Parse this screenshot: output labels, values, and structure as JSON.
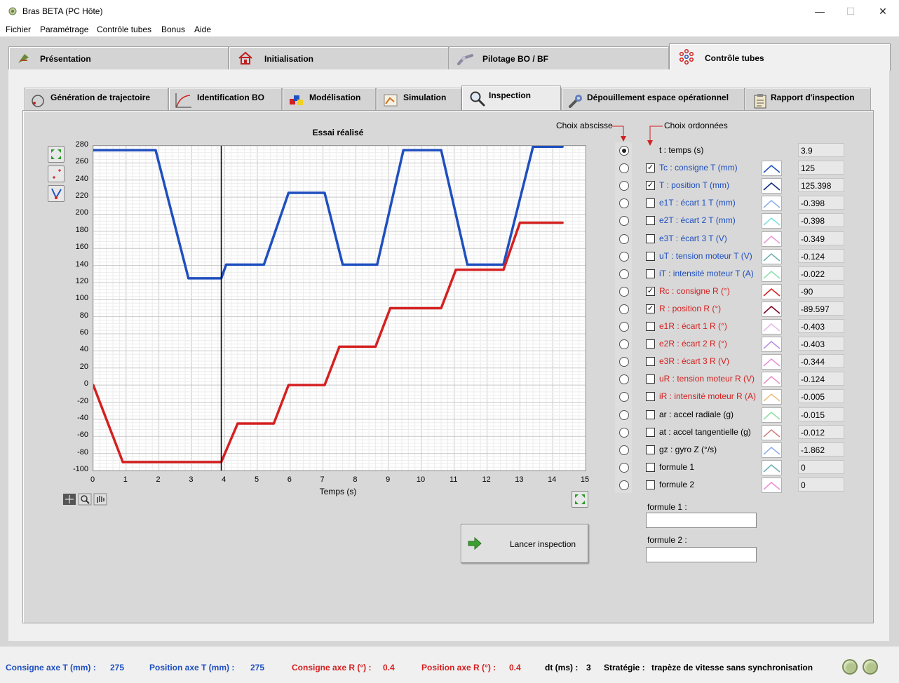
{
  "window": {
    "title": "Bras BETA (PC Hôte)",
    "minimize": "—",
    "maximize": "☐",
    "close": "✕"
  },
  "menu": [
    "Fichier",
    "Paramétrage",
    "Contrôle tubes",
    "Bonus",
    "Aide"
  ],
  "top_tabs": [
    "Présentation",
    "Initialisation",
    "Pilotage BO / BF",
    "Contrôle tubes"
  ],
  "sub_tabs": [
    "Génération de trajectoire",
    "Identification BO",
    "Modélisation",
    "Simulation",
    "Inspection",
    "Dépouillement espace opérationnel",
    "Rapport d'inspection"
  ],
  "chart": {
    "title": "Essai réalisé",
    "xlabel": "Temps (s)"
  },
  "chart_data": {
    "type": "line",
    "title": "Essai réalisé",
    "xlabel": "Temps (s)",
    "ylabel": "",
    "xlim": [
      0,
      15
    ],
    "ylim": [
      -100,
      280
    ],
    "x_ticks": [
      0,
      1,
      2,
      3,
      4,
      5,
      6,
      7,
      8,
      9,
      10,
      11,
      12,
      13,
      14,
      15
    ],
    "y_ticks": [
      280,
      260,
      240,
      220,
      200,
      180,
      160,
      140,
      120,
      100,
      80,
      60,
      40,
      20,
      0,
      -20,
      -40,
      -60,
      -80,
      -100
    ],
    "grid": true,
    "cursor_x": 3.9,
    "series": [
      {
        "name": "Tc : consigne T (mm)",
        "color": "#1f4fbf",
        "x": [
          0,
          1.9,
          2.9,
          3.9,
          4.05,
          5.2,
          5.95,
          7.05,
          7.6,
          8.65,
          9.45,
          10.6,
          11.4,
          12.5,
          13.4,
          14.3
        ],
        "y": [
          275,
          275,
          125,
          125,
          141,
          141,
          225,
          225,
          141,
          141,
          275,
          275,
          141,
          141,
          279,
          279
        ]
      },
      {
        "name": "Rc : consigne R (°)",
        "color": "#d42020",
        "x": [
          0,
          0.9,
          3.9,
          4.4,
          5.5,
          5.95,
          7.05,
          7.5,
          8.6,
          9.05,
          10.6,
          11.05,
          12.5,
          13.0,
          14.3
        ],
        "y": [
          0,
          -90,
          -90,
          -45,
          -45,
          0,
          0,
          45,
          45,
          90,
          90,
          135,
          135,
          190,
          190
        ]
      }
    ]
  },
  "abscisse_title": "Choix abscisse",
  "ordonnees_title": "Choix ordonnées",
  "signals": [
    {
      "label": "t : temps (s)",
      "color": "#000000",
      "checkbox": false,
      "checked": false,
      "value": "3.9",
      "radio": true,
      "swatch": null
    },
    {
      "label": "Tc : consigne T (mm)",
      "color": "#1f4fbf",
      "checkbox": true,
      "checked": true,
      "value": "125",
      "radio": false,
      "swatch": "#1f4fbf"
    },
    {
      "label": "T : position T (mm)",
      "color": "#1f4fbf",
      "checkbox": true,
      "checked": true,
      "value": "125.398",
      "radio": false,
      "swatch": "#0d2b80"
    },
    {
      "label": "e1T : écart 1 T (mm)",
      "color": "#1f4fbf",
      "checkbox": true,
      "checked": false,
      "value": "-0.398",
      "radio": false,
      "swatch": "#8fb0e8"
    },
    {
      "label": "e2T : écart 2 T (mm)",
      "color": "#1f4fbf",
      "checkbox": true,
      "checked": false,
      "value": "-0.398",
      "radio": false,
      "swatch": "#7fe0e0"
    },
    {
      "label": "e3T : écart 3 T (V)",
      "color": "#1f4fbf",
      "checkbox": true,
      "checked": false,
      "value": "-0.349",
      "radio": false,
      "swatch": "#e89ad8"
    },
    {
      "label": "uT : tension moteur T (V)",
      "color": "#1f4fbf",
      "checkbox": true,
      "checked": false,
      "value": "-0.124",
      "radio": false,
      "swatch": "#70b0b0"
    },
    {
      "label": "iT : intensité moteur T (A)",
      "color": "#1f4fbf",
      "checkbox": true,
      "checked": false,
      "value": "-0.022",
      "radio": false,
      "swatch": "#8fe0b0"
    },
    {
      "label": "Rc : consigne R (°)",
      "color": "#d42020",
      "checkbox": true,
      "checked": true,
      "value": "-90",
      "radio": false,
      "swatch": "#d42020"
    },
    {
      "label": "R : position R (°)",
      "color": "#d42020",
      "checkbox": true,
      "checked": true,
      "value": "-89.597",
      "radio": false,
      "swatch": "#800020"
    },
    {
      "label": "e1R : écart 1 R (°)",
      "color": "#d42020",
      "checkbox": true,
      "checked": false,
      "value": "-0.403",
      "radio": false,
      "swatch": "#e8b8e8"
    },
    {
      "label": "e2R : écart 2 R (°)",
      "color": "#d42020",
      "checkbox": true,
      "checked": false,
      "value": "-0.403",
      "radio": false,
      "swatch": "#b890e8"
    },
    {
      "label": "e3R : écart 3 R (V)",
      "color": "#d42020",
      "checkbox": true,
      "checked": false,
      "value": "-0.344",
      "radio": false,
      "swatch": "#e890d8"
    },
    {
      "label": "uR : tension moteur R (V)",
      "color": "#d42020",
      "checkbox": true,
      "checked": false,
      "value": "-0.124",
      "radio": false,
      "swatch": "#e890c8"
    },
    {
      "label": "iR : intensité moteur R (A)",
      "color": "#d42020",
      "checkbox": true,
      "checked": false,
      "value": "-0.005",
      "radio": false,
      "swatch": "#f0c080"
    },
    {
      "label": "ar : accel radiale (g)",
      "color": "#000000",
      "checkbox": true,
      "checked": false,
      "value": "-0.015",
      "radio": false,
      "swatch": "#90e0a0"
    },
    {
      "label": "at : accel tangentielle (g)",
      "color": "#000000",
      "checkbox": true,
      "checked": false,
      "value": "-0.012",
      "radio": false,
      "swatch": "#d08080"
    },
    {
      "label": "gz : gyro Z (°/s)",
      "color": "#000000",
      "checkbox": true,
      "checked": false,
      "value": "-1.862",
      "radio": false,
      "swatch": "#8fb0e8"
    },
    {
      "label": "formule 1",
      "color": "#000000",
      "checkbox": true,
      "checked": false,
      "value": "0",
      "radio": false,
      "swatch": "#70b0b0"
    },
    {
      "label": "formule 2",
      "color": "#000000",
      "checkbox": true,
      "checked": false,
      "value": "0",
      "radio": false,
      "swatch": "#e890d8"
    }
  ],
  "formula1_label": "formule 1 :",
  "formula2_label": "formule 2 :",
  "formula1_value": "",
  "formula2_value": "",
  "launch_button": "Lancer inspection",
  "status": [
    {
      "label": "Consigne axe T (mm) :",
      "value": "275",
      "color": "#1f4fbf"
    },
    {
      "label": "Position axe T (mm) :",
      "value": "275",
      "color": "#1f4fbf"
    },
    {
      "label": "Consigne axe R (°) :",
      "value": "0.4",
      "color": "#d42020"
    },
    {
      "label": "Position axe R (°) :",
      "value": "0.4",
      "color": "#d42020"
    },
    {
      "label": "dt (ms) :",
      "value": "3",
      "color": "#000000"
    },
    {
      "label": "Stratégie :",
      "value": "trapèze de vitesse sans synchronisation",
      "color": "#000000"
    }
  ]
}
